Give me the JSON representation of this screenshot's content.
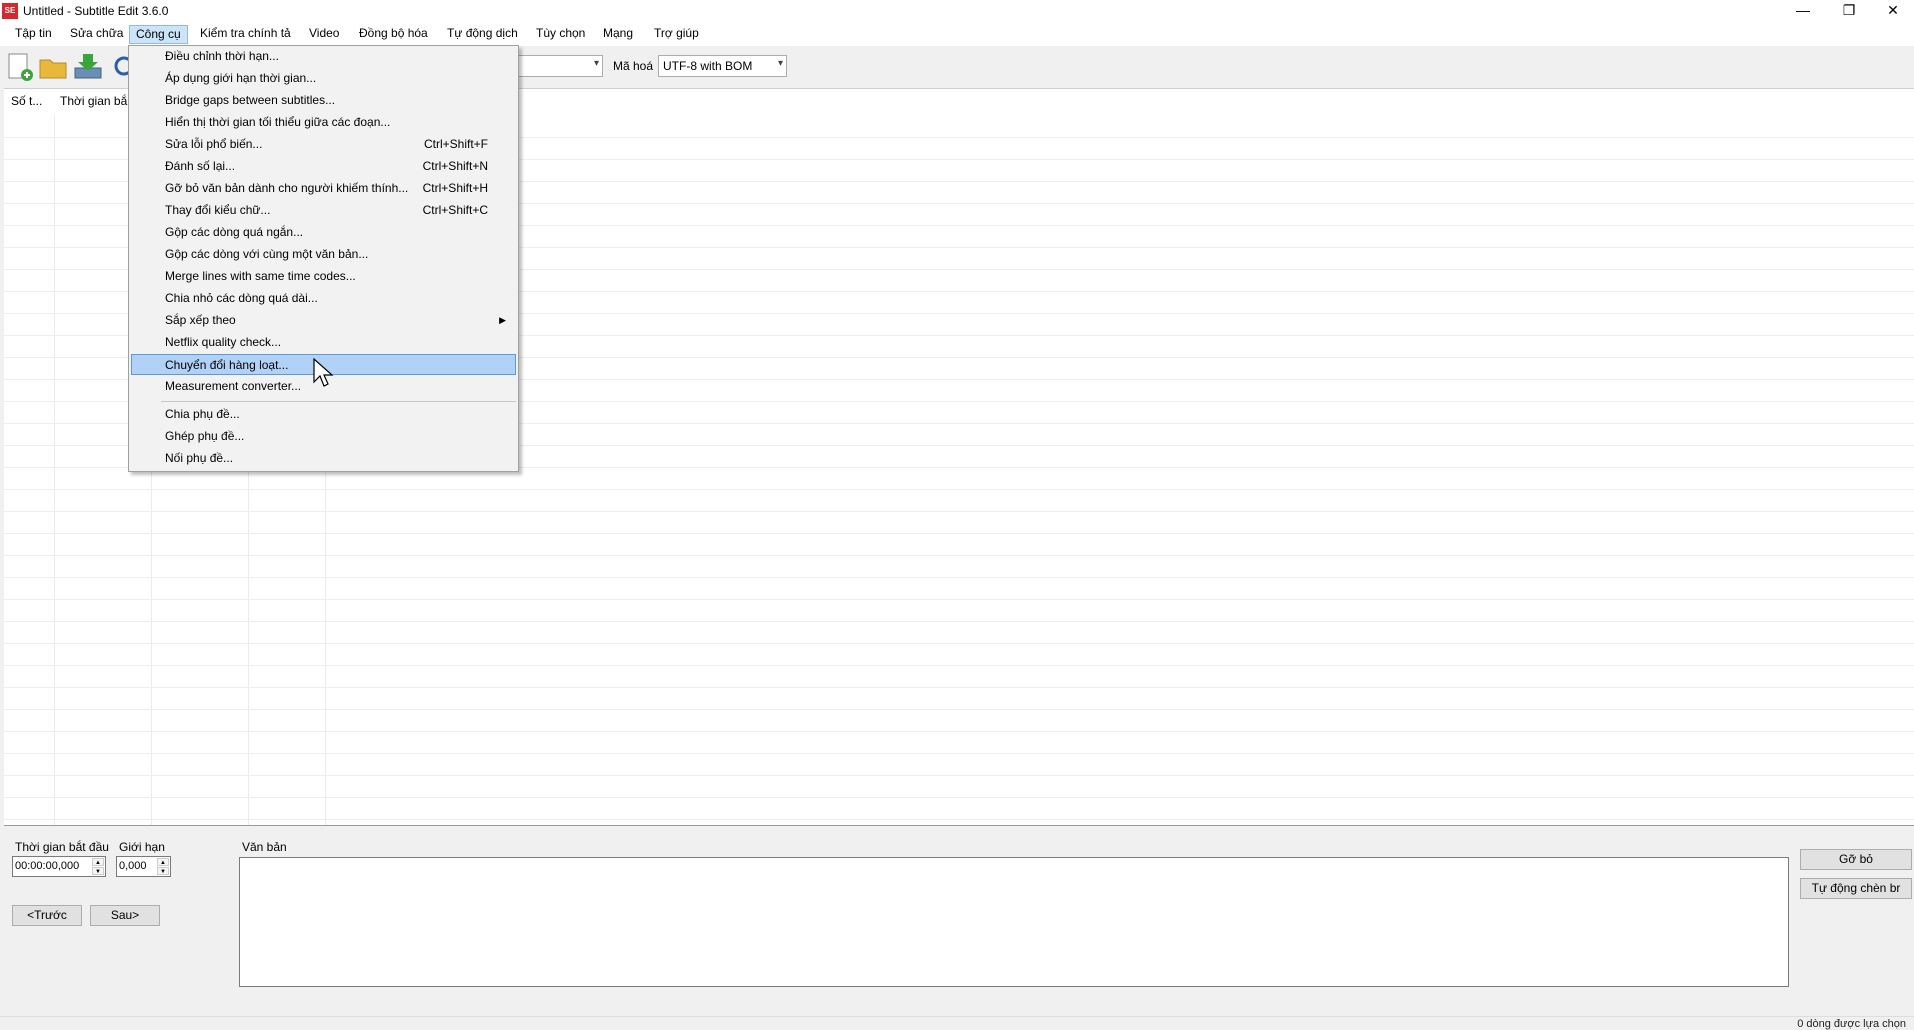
{
  "window": {
    "title": "Untitled - Subtitle Edit 3.6.0",
    "icon": "SE",
    "controls": {
      "minimize": "—",
      "maximize": "❐",
      "close": "✕"
    }
  },
  "menubar": {
    "items": [
      {
        "label": "Tập tin"
      },
      {
        "label": "Sửa chữa"
      },
      {
        "label": "Công cụ"
      },
      {
        "label": "Kiểm tra chính tả"
      },
      {
        "label": "Video"
      },
      {
        "label": "Đồng bộ hóa"
      },
      {
        "label": "Tự động dịch"
      },
      {
        "label": "Tùy chọn"
      },
      {
        "label": "Mạng"
      },
      {
        "label": "Trợ giúp"
      }
    ]
  },
  "toolbar": {
    "encoding_label": "Mã hoá",
    "encoding_value": "UTF-8 with BOM",
    "format_value": ""
  },
  "grid": {
    "columns": [
      "Số t...",
      "Thời gian bắ"
    ]
  },
  "tools_menu": {
    "items": [
      {
        "label": "Điều chỉnh thời hạn...",
        "shortcut": ""
      },
      {
        "label": "Áp dụng giới hạn thời gian...",
        "shortcut": ""
      },
      {
        "label": "Bridge gaps between subtitles...",
        "shortcut": ""
      },
      {
        "label": "Hiển thị thời gian tối thiểu giữa các đoạn...",
        "shortcut": ""
      },
      {
        "label": "Sửa lỗi phổ biến...",
        "shortcut": "Ctrl+Shift+F"
      },
      {
        "label": "Đánh số lại...",
        "shortcut": "Ctrl+Shift+N"
      },
      {
        "label": "Gỡ bỏ văn bản dành cho người khiếm thính...",
        "shortcut": "Ctrl+Shift+H"
      },
      {
        "label": "Thay đổi kiểu chữ...",
        "shortcut": "Ctrl+Shift+C"
      },
      {
        "label": "Gộp các dòng quá ngắn...",
        "shortcut": ""
      },
      {
        "label": "Gộp các dòng với cùng một văn bản...",
        "shortcut": ""
      },
      {
        "label": "Merge lines with same time codes...",
        "shortcut": ""
      },
      {
        "label": "Chia nhỏ các dòng quá dài...",
        "shortcut": ""
      },
      {
        "label": "Sắp xếp theo",
        "shortcut": ""
      },
      {
        "label": "Netflix quality check...",
        "shortcut": ""
      },
      {
        "label": "Chuyển đổi hàng loạt...",
        "shortcut": ""
      },
      {
        "label": "Measurement converter...",
        "shortcut": ""
      },
      {
        "label": "Chia phụ đề...",
        "shortcut": ""
      },
      {
        "label": "Ghép phụ đề...",
        "shortcut": ""
      },
      {
        "label": "Nối phụ đề...",
        "shortcut": ""
      }
    ]
  },
  "editor": {
    "start_time_label": "Thời gian bắt đầu",
    "start_time_value": "00:00:00,000",
    "duration_label": "Giới hạn",
    "duration_value": "0,000",
    "text_label": "Văn bản",
    "prev_button": "<Trước",
    "next_button": "Sau>",
    "remove_button": "Gỡ bỏ",
    "auto_br_button": "Tự động chèn br"
  },
  "status": {
    "text": "0 dòng được lựa chọn"
  }
}
